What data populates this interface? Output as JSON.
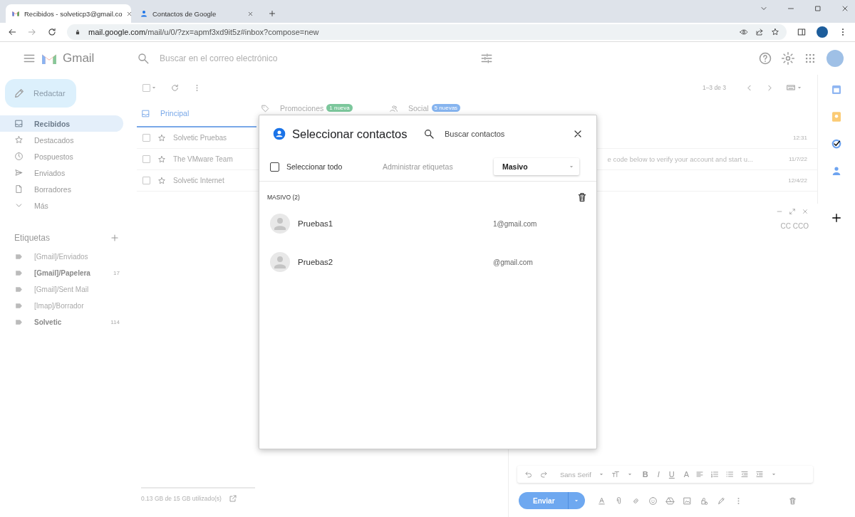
{
  "browser": {
    "tabs": [
      {
        "title": "Recibidos - solveticp3@gmail.co",
        "kind": "gmail",
        "selected": true
      },
      {
        "title": "Contactos de Google",
        "kind": "contacts",
        "selected": false
      }
    ],
    "url_host": "mail.google.com",
    "url_path": "/mail/u/0/?zx=apmf3xd9it5z#inbox?compose=new"
  },
  "header": {
    "app_name": "Gmail",
    "search": {
      "placeholder": "Buscar en el correo electrónico"
    }
  },
  "sidebar": {
    "compose_button": "Redactar",
    "items": [
      {
        "label": "Recibidos",
        "kind": "inbox",
        "selected": true
      },
      {
        "label": "Destacados",
        "kind": "star",
        "selected": false
      },
      {
        "label": "Pospuestos",
        "kind": "clock",
        "selected": false
      },
      {
        "label": "Enviados",
        "kind": "send",
        "selected": false
      },
      {
        "label": "Borradores",
        "kind": "file",
        "selected": false
      },
      {
        "label": "Más",
        "kind": "chevron",
        "selected": false
      }
    ],
    "labels_title": "Etiquetas",
    "labels": [
      {
        "name": "[Gmail]/Enviados",
        "unread": false
      },
      {
        "name": "[Gmail]/Papelera",
        "unread": true,
        "count": "17"
      },
      {
        "name": "[Gmail]/Sent Mail",
        "unread": false
      },
      {
        "name": "[Imap]/Borrador",
        "unread": false
      },
      {
        "name": "Solvetic",
        "unread": true,
        "count": "114"
      }
    ]
  },
  "toolbar": {
    "select_all_checked": false,
    "pagination": "1–3 de 3"
  },
  "tabs": [
    {
      "label": "Principal",
      "kind": "inbox",
      "selected": true
    },
    {
      "label": "Promociones",
      "kind": "tag",
      "badge": "1 nueva",
      "color": "#7cc79c",
      "selected": false
    },
    {
      "label": "Social",
      "kind": "people",
      "badge": "5 nuevas",
      "color": "#86b4ef",
      "selected": false
    }
  ],
  "messages": [
    {
      "checked": false,
      "sender": "Solvetic Pruebas",
      "date": "12:31"
    },
    {
      "checked": false,
      "sender": "The VMware Team",
      "snippet": "e code below to verify your account and start u...",
      "date": "11/7/22"
    },
    {
      "checked": false,
      "sender": "Solvetic Internet",
      "date": "12/4/22"
    }
  ],
  "storage": "0.13 GB de 15 GB utilizado(s)",
  "compose": {
    "cc": "CC CCO",
    "font": "Sans Serif",
    "format": [
      "B",
      "I",
      "U",
      "A"
    ],
    "send": "Enviar"
  },
  "dialog": {
    "title": "Seleccionar contactos",
    "search": {
      "placeholder": "Buscar contactos"
    },
    "select_all": {
      "label": "Seleccionar todo",
      "checked": false
    },
    "manage_labels": "Administrar etiquetas",
    "label_select": "Masivo",
    "group_title": "MASIVO (2)",
    "contacts": [
      {
        "name": "Pruebas1",
        "email": "1@gmail.com"
      },
      {
        "name": "Pruebas2",
        "email": "@gmail.com"
      }
    ]
  }
}
